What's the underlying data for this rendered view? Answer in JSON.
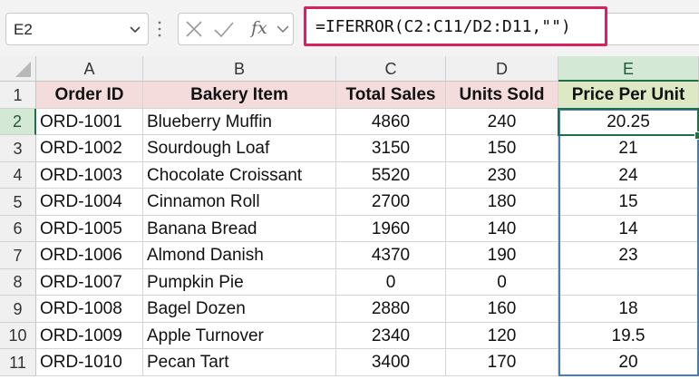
{
  "formula_bar": {
    "name_box": "E2",
    "fx_label": "fx",
    "formula": "=IFERROR(C2:C11/D2:D11,\"\")"
  },
  "columns": [
    "A",
    "B",
    "C",
    "D",
    "E"
  ],
  "header_row": [
    "Order ID",
    "Bakery Item",
    "Total Sales",
    "Units Sold",
    "Price Per Unit"
  ],
  "rows": [
    {
      "n": "2",
      "cells": [
        "ORD-1001",
        "Blueberry Muffin",
        "4860",
        "240",
        "20.25"
      ]
    },
    {
      "n": "3",
      "cells": [
        "ORD-1002",
        "Sourdough Loaf",
        "3150",
        "150",
        "21"
      ]
    },
    {
      "n": "4",
      "cells": [
        "ORD-1003",
        "Chocolate Croissant",
        "5520",
        "230",
        "24"
      ]
    },
    {
      "n": "5",
      "cells": [
        "ORD-1004",
        "Cinnamon Roll",
        "2700",
        "180",
        "15"
      ]
    },
    {
      "n": "6",
      "cells": [
        "ORD-1005",
        "Banana Bread",
        "1960",
        "140",
        "14"
      ]
    },
    {
      "n": "7",
      "cells": [
        "ORD-1006",
        "Almond Danish",
        "4370",
        "190",
        "23"
      ]
    },
    {
      "n": "8",
      "cells": [
        "ORD-1007",
        "Pumpkin Pie",
        "0",
        "0",
        ""
      ]
    },
    {
      "n": "9",
      "cells": [
        "ORD-1008",
        "Bagel Dozen",
        "2880",
        "160",
        "18"
      ]
    },
    {
      "n": "10",
      "cells": [
        "ORD-1009",
        "Apple Turnover",
        "2340",
        "120",
        "19.5"
      ]
    },
    {
      "n": "11",
      "cells": [
        "ORD-1010",
        "Pecan Tart",
        "3400",
        "170",
        "20"
      ]
    }
  ],
  "header_row_number": "1",
  "colors": {
    "header_fill": "#f4dcdc",
    "header_fill_e": "#dde8c5",
    "formula_highlight": "#d6235f",
    "active_cell": "#1e7145",
    "spill_range": "#4a7bc0"
  }
}
